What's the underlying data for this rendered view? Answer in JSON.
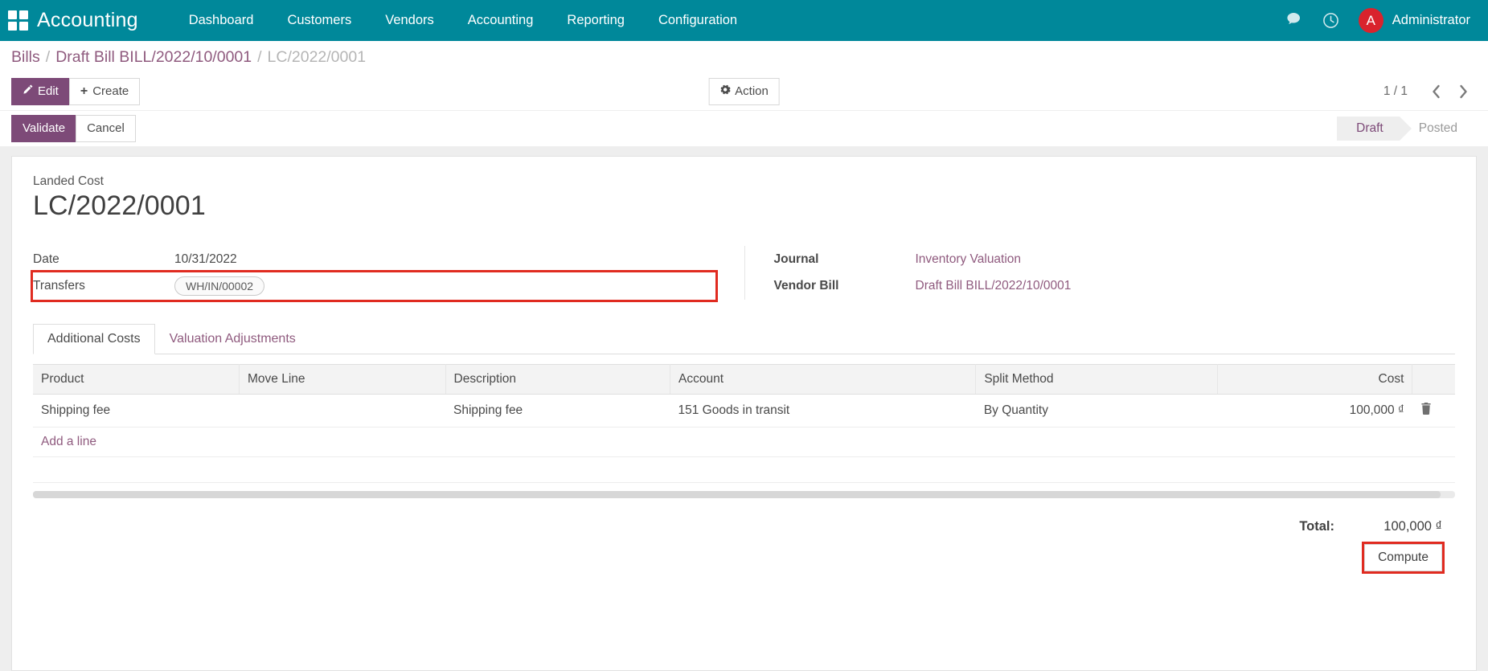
{
  "navbar": {
    "apps_icon": "apps-grid-icon",
    "brand": "Accounting",
    "menu": [
      {
        "label": "Dashboard"
      },
      {
        "label": "Customers"
      },
      {
        "label": "Vendors"
      },
      {
        "label": "Accounting"
      },
      {
        "label": "Reporting"
      },
      {
        "label": "Configuration"
      }
    ],
    "messages_icon": "chat-bubble-icon",
    "activities_icon": "clock-icon",
    "avatar_initial": "A",
    "user_name": "Administrator",
    "bg_color": "#00889a",
    "avatar_color": "#d9232d"
  },
  "breadcrumb": {
    "root": "Bills",
    "parent": "Draft Bill BILL/2022/10/0001",
    "current": "LC/2022/0001",
    "separator": "/"
  },
  "controlpanel": {
    "edit_label": "Edit",
    "edit_icon": "pencil-icon",
    "create_label": "Create",
    "create_icon": "plus-icon",
    "action_label": "Action",
    "action_icon": "gear-icon",
    "pager_value": "1 / 1",
    "prev_icon": "chevron-left-icon",
    "next_icon": "chevron-right-icon"
  },
  "statusrow": {
    "validate_label": "Validate",
    "cancel_label": "Cancel",
    "states": [
      {
        "label": "Draft",
        "active": true
      },
      {
        "label": "Posted",
        "active": false
      }
    ]
  },
  "form": {
    "model_label": "Landed Cost",
    "record_name": "LC/2022/0001",
    "left_fields": [
      {
        "label": "Date",
        "value": "10/31/2022",
        "type": "text"
      },
      {
        "label": "Transfers",
        "value": "WH/IN/00002",
        "type": "tag",
        "highlighted": true
      }
    ],
    "right_fields": [
      {
        "label": "Journal",
        "value": "Inventory Valuation",
        "type": "link"
      },
      {
        "label": "Vendor Bill",
        "value": "Draft Bill BILL/2022/10/0001",
        "type": "link"
      }
    ]
  },
  "notebook": {
    "tabs": [
      {
        "label": "Additional Costs",
        "active": true
      },
      {
        "label": "Valuation Adjustments",
        "active": false
      }
    ]
  },
  "table": {
    "columns": [
      "Product",
      "Move Line",
      "Description",
      "Account",
      "Split Method",
      "Cost"
    ],
    "rows": [
      {
        "product": "Shipping fee",
        "move_line": "",
        "description": "Shipping fee",
        "account": "151 Goods in transit",
        "split_method": "By Quantity",
        "cost": "100,000 ₫",
        "delete_icon": "trash-icon"
      }
    ],
    "add_line_label": "Add a line"
  },
  "footer": {
    "total_label": "Total:",
    "total_value": "100,000 ₫",
    "compute_label": "Compute",
    "compute_highlighted": true
  },
  "highlight_color": "#e02b20"
}
